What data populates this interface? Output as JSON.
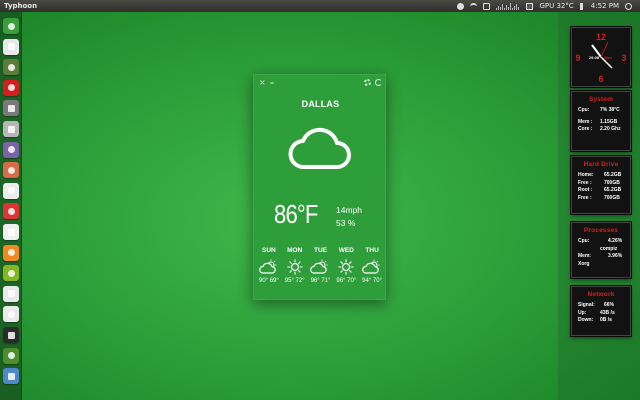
{
  "top_panel": {
    "window_title": "Typhoon",
    "gpu_label": "GPU 32°C",
    "time": "4:52 PM"
  },
  "launcher": {
    "items": [
      {
        "name": "home-folder",
        "color": "#3a9e3a"
      },
      {
        "name": "files",
        "color": "#e8e8e8"
      },
      {
        "name": "onion-browser",
        "color": "#5c7d3a"
      },
      {
        "name": "opera-browser",
        "color": "#d71e1e"
      },
      {
        "name": "system-monitor",
        "color": "#7a7a7a"
      },
      {
        "name": "hard-drive",
        "color": "#b7b7b7"
      },
      {
        "name": "database",
        "color": "#7b63a8"
      },
      {
        "name": "software-center",
        "color": "#d86b4a"
      },
      {
        "name": "usb",
        "color": "#ececec"
      },
      {
        "name": "record",
        "color": "#dd3535"
      },
      {
        "name": "document",
        "color": "#f0f0f0"
      },
      {
        "name": "media-player",
        "color": "#f08a1e"
      },
      {
        "name": "spotify",
        "color": "#84b81f"
      },
      {
        "name": "text-editor",
        "color": "#e9e9e9"
      },
      {
        "name": "dock-settings",
        "color": "#eaeaea"
      },
      {
        "name": "terminal",
        "color": "#2a2a2a"
      },
      {
        "name": "power",
        "color": "#4a8f2a"
      },
      {
        "name": "trash",
        "color": "#4d88c7"
      }
    ]
  },
  "weather": {
    "close": "×",
    "minimize": "–",
    "city": "DALLAS",
    "temperature": "86°F",
    "wind": "14mph",
    "humidity": "53 %",
    "forecast": [
      {
        "day": "SUN",
        "icon": "partly-cloudy",
        "temps": "90° 69°"
      },
      {
        "day": "MON",
        "icon": "sunny",
        "temps": "95° 72°"
      },
      {
        "day": "TUE",
        "icon": "partly-cloudy",
        "temps": "96° 71°"
      },
      {
        "day": "WED",
        "icon": "sunny",
        "temps": "96° 70°"
      },
      {
        "day": "THU",
        "icon": "partly-cloudy",
        "temps": "94° 70°"
      }
    ]
  },
  "clock": {
    "numeral_12": "12",
    "numeral_3": "3",
    "numeral_6": "6",
    "numeral_9": "9",
    "date": "29-08",
    "day": "Sun"
  },
  "system": {
    "title": "System",
    "cpu_label": "Cpu:",
    "cpu_value": "7%  38°C",
    "mem_label": "Mem :",
    "mem_value": "1.15GB",
    "core_label": "Core :",
    "core_value": "2.20 Ghz"
  },
  "hard_drive": {
    "title": "Hard Drive",
    "rows": [
      {
        "label": "Home:",
        "value": "65.2GB"
      },
      {
        "label": "Free :",
        "value": "700GB"
      },
      {
        "label": "Root :",
        "value": "65.2GB"
      },
      {
        "label": "Free :",
        "value": "700GB"
      }
    ]
  },
  "processes": {
    "title": "Processes",
    "cpu_label": "Cpu:",
    "cpu_value": "4.26%",
    "cpu_proc": "compiz",
    "mem_label": "Mem:",
    "mem_value": "3.96%",
    "mem_proc": "Xorg"
  },
  "network": {
    "title": "Network",
    "signal_label": "Signal:",
    "signal_value": "66%",
    "up_label": "Up:",
    "up_value": "43B /s",
    "down_label": "Down:",
    "down_value": "0B /s"
  },
  "colors": {
    "accent_red": "#d42020",
    "widget_green": "#2e9e3b"
  }
}
